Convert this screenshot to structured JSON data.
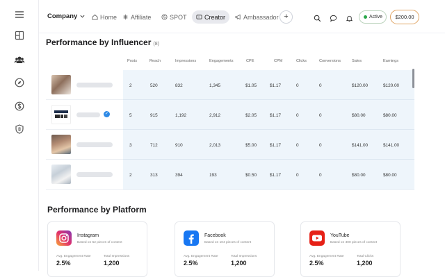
{
  "topbar": {
    "company": "Company",
    "tabs": [
      {
        "label": "Home",
        "icon": "home-icon"
      },
      {
        "label": "Affiliate",
        "icon": "affiliate-icon"
      },
      {
        "label": "SPOT",
        "icon": "spot-icon"
      },
      {
        "label": "Creator",
        "icon": "creator-icon",
        "active": true
      },
      {
        "label": "Ambassador",
        "icon": "megaphone-icon"
      }
    ],
    "add_label": "+",
    "status": "Active",
    "balance": "$200.00"
  },
  "influencer_section": {
    "title": "Performance by Influencer",
    "count": "(8)",
    "columns": [
      "Posts",
      "Reach",
      "Impressions",
      "Engagements",
      "CPE",
      "CPM",
      "Clicks",
      "Conversions",
      "Sales",
      "Earnings"
    ],
    "rows": [
      {
        "posts": "2",
        "reach": "520",
        "impressions": "832",
        "engagements": "1,345",
        "cpe": "$1.05",
        "cpm": "$1.17",
        "clicks": "0",
        "conversions": "0",
        "sales": "$120.00",
        "earnings": "$120.00"
      },
      {
        "posts": "5",
        "reach": "915",
        "impressions": "1,192",
        "engagements": "2,912",
        "cpe": "$2.05",
        "cpm": "$1.17",
        "clicks": "0",
        "conversions": "0",
        "sales": "$80.00",
        "earnings": "$80.00",
        "verified": true
      },
      {
        "posts": "3",
        "reach": "712",
        "impressions": "910",
        "engagements": "2,013",
        "cpe": "$5.00",
        "cpm": "$1.17",
        "clicks": "0",
        "conversions": "0",
        "sales": "$141.00",
        "earnings": "$141.00"
      },
      {
        "posts": "2",
        "reach": "313",
        "impressions": "394",
        "engagements": "193",
        "cpe": "$0.50",
        "cpm": "$1.17",
        "clicks": "0",
        "conversions": "0",
        "sales": "$80.00",
        "earnings": "$80.00"
      }
    ]
  },
  "platform_section": {
    "title": "Performance by Platform",
    "cards": [
      {
        "name": "Instagram",
        "subtitle": "Based on 52 pieces of content",
        "metric1_label": "Avg. Engagement Rate",
        "metric1_value": "2.5%",
        "metric2_label": "Total Impressions",
        "metric2_value": "1,200",
        "color": "#c13584"
      },
      {
        "name": "Facebook",
        "subtitle": "Based on 104 pieces of content",
        "metric1_label": "Avg. Engagement Rate",
        "metric1_value": "2.5%",
        "metric2_label": "Total Impressions",
        "metric2_value": "1,200",
        "color": "#1877f2"
      },
      {
        "name": "YouTube",
        "subtitle": "Based on 300 pieces of content",
        "metric1_label": "Avg. Engagement Rate",
        "metric1_value": "2.5%",
        "metric2_label": "Total Clicks",
        "metric2_value": "1,200",
        "color": "#e62117"
      }
    ]
  },
  "colors": {
    "accent_active": "#2aa84a",
    "balance_border": "#e0a463",
    "table_bg": "#eef5fb"
  }
}
